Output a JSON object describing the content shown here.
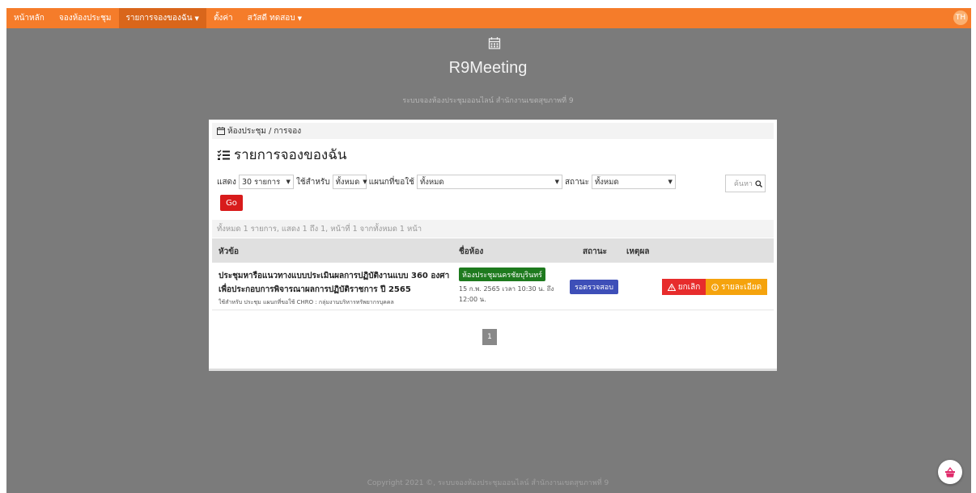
{
  "navbar": {
    "items": [
      {
        "label": "หน้าหลัก"
      },
      {
        "label": "จองห้องประชุม"
      },
      {
        "label": "รายการจองของฉัน"
      },
      {
        "label": "ตั้งค่า"
      },
      {
        "label": "สวัสดี ทดสอบ"
      }
    ],
    "lang": "TH",
    "accent": "#f57c2a"
  },
  "header": {
    "title": "R9Meeting",
    "subtitle": "ระบบจองห้องประชุมออนไลน์ สำนักงานเขตสุขภาพที่ 9"
  },
  "breadcrumb": {
    "root": "ห้องประชุม",
    "separator": "/",
    "current": "การจอง"
  },
  "page_title": "รายการจองของฉัน",
  "filters": {
    "show_label": "แสดง",
    "show_value": "30 รายการ",
    "use_label": "ใช้สำหรับ",
    "use_value": "ทั้งหมด",
    "dept_label": "แผนกที่ขอใช้",
    "dept_value": "ทั้งหมด",
    "status_label": "สถานะ",
    "status_value": "ทั้งหมด",
    "search_placeholder": "ค้นหา",
    "go_label": "Go"
  },
  "summary": "ทั้งหมด 1 รายการ, แสดง 1 ถึง 1, หน้าที่ 1 จากทั้งหมด 1 หน้า",
  "table": {
    "headers": [
      "หัวข้อ",
      "ชื่อห้อง",
      "สถานะ",
      "เหตุผล"
    ],
    "rows": [
      {
        "topic_line1": "ประชุมหารือแนวทางแบบประเมินผลการปฏิบัติงานแบบ 360 องศา",
        "topic_line2": "เพื่อประกอบการพิจารณาผลการปฏิบัติราชการ ปี 2565",
        "meta": "ใช้สำหรับ ประชุม แผนกที่ขอใช้ CHRO : กลุ่มงานบริหารทรัพยากรบุคคล",
        "room": "ห้องประชุมนครชัยบุรินทร์",
        "time": "15 ก.พ. 2565 เวลา 10:30 น. ถึง 12:00 น.",
        "status": "รอตรวจสอบ",
        "cancel_label": "ยกเลิก",
        "detail_label": "รายละเอียด"
      }
    ]
  },
  "pagination": {
    "current": "1"
  },
  "footer": "Copyright 2021 ©, ระบบจองห้องประชุมออนไลน์ สำนักงานเขตสุขภาพที่ 9"
}
